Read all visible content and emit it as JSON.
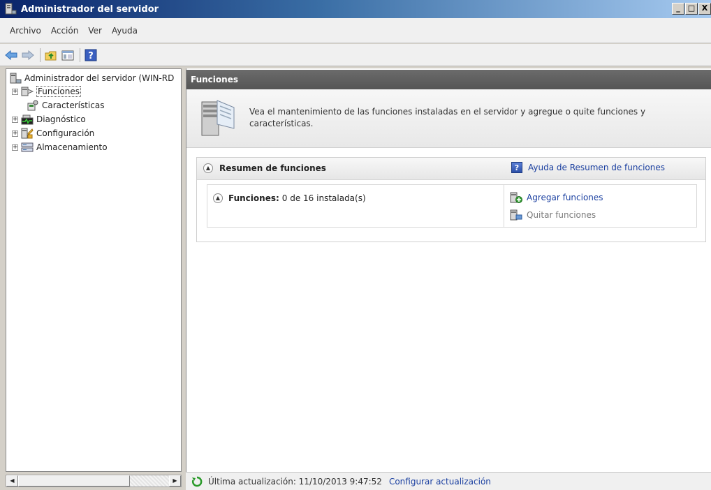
{
  "window": {
    "title": "Administrador del servidor",
    "buttons": [
      "_",
      "□",
      "X"
    ]
  },
  "menubar": {
    "items": [
      "Archivo",
      "Acción",
      "Ver",
      "Ayuda"
    ]
  },
  "toolbar": {
    "buttons": [
      "back-icon",
      "forward-icon",
      "up-folder-icon",
      "show-hide-pane-icon",
      "help-icon"
    ]
  },
  "tree": {
    "root": "Administrador del servidor (WIN-RD",
    "items": [
      {
        "label": "Funciones",
        "expandable": true,
        "selected": true
      },
      {
        "label": "Características",
        "expandable": false
      },
      {
        "label": "Diagnóstico",
        "expandable": true
      },
      {
        "label": "Configuración",
        "expandable": true
      },
      {
        "label": "Almacenamiento",
        "expandable": true
      }
    ]
  },
  "content": {
    "header": "Funciones",
    "intro": "Vea el mantenimiento de las funciones instaladas en el servidor y agregue o quite funciones y características.",
    "summary": {
      "title": "Resumen de funciones",
      "help_link": "Ayuda de Resumen de funciones",
      "funciones_label": "Funciones:",
      "funciones_value": "0 de 16 instalada(s)",
      "actions": {
        "add": "Agregar funciones",
        "remove": "Quitar funciones"
      }
    }
  },
  "status": {
    "last_update_label": "Última actualización: 11/10/2013 9:47:52",
    "configure_link": "Configurar actualización"
  },
  "colors": {
    "link": "#1a3fa0",
    "title_bar": "#0a246a",
    "header": "#606060"
  }
}
